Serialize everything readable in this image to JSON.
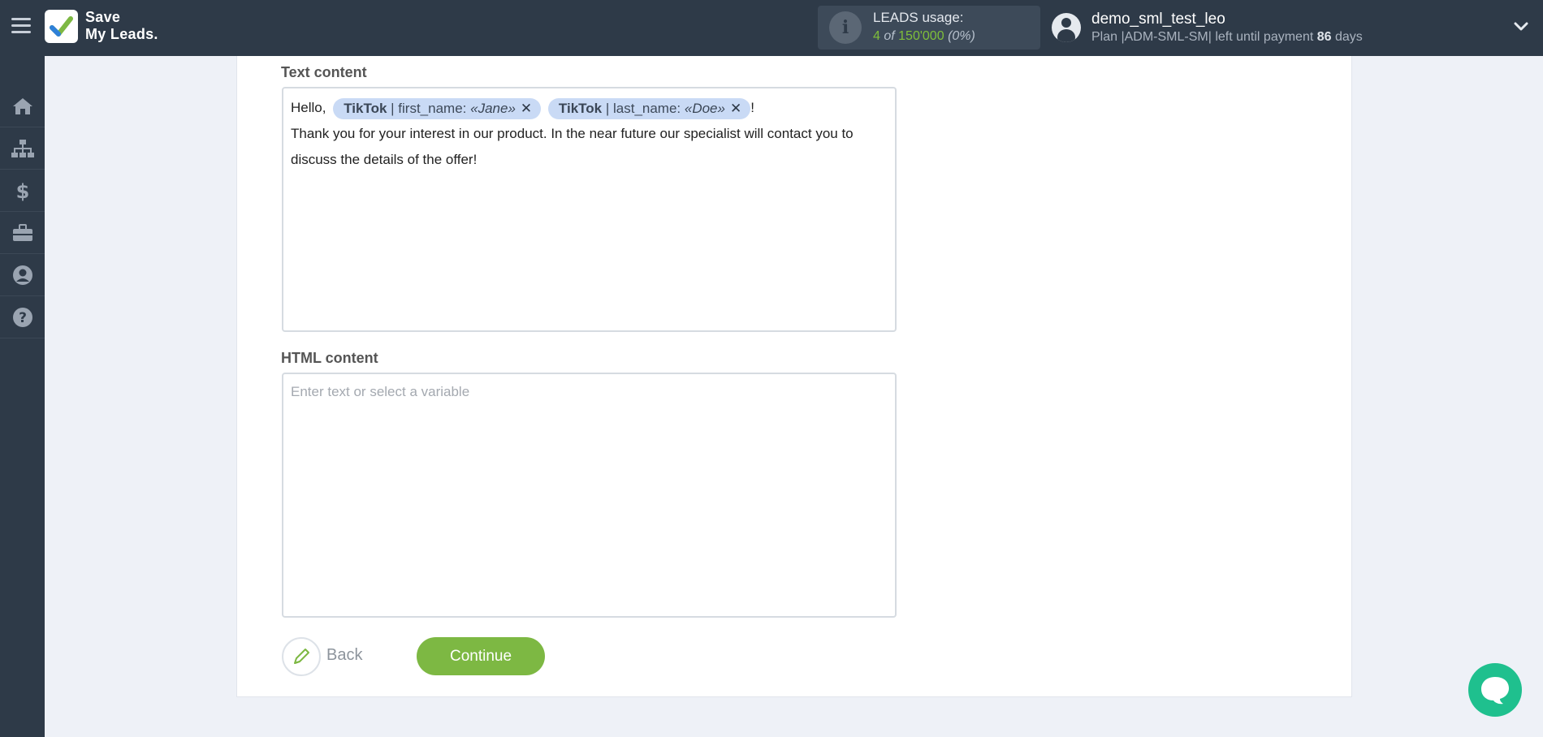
{
  "header": {
    "logo_line1": "Save",
    "logo_line2": "My Leads.",
    "usage_label": "LEADS usage:",
    "usage_used": "4",
    "usage_of": "of",
    "usage_total": "150'000",
    "usage_percent": "(0%)",
    "user_name": "demo_sml_test_leo",
    "plan_prefix": "Plan |ADM-SML-SM| left until payment",
    "plan_days": "86",
    "plan_suffix": "days"
  },
  "sidebar": {
    "items": [
      {
        "icon": "home-icon"
      },
      {
        "icon": "sitemap-icon"
      },
      {
        "icon": "dollar-icon"
      },
      {
        "icon": "briefcase-icon"
      },
      {
        "icon": "user-icon"
      },
      {
        "icon": "help-icon"
      }
    ]
  },
  "form": {
    "text_content_label": "Text content",
    "text_greeting": "Hello,",
    "chip1_source": "TikTok",
    "chip1_field": "| first_name:",
    "chip1_value": "«Jane»",
    "chip2_source": "TikTok",
    "chip2_field": "| last_name:",
    "chip2_value": "«Doe»",
    "text_exclaim": "!",
    "text_body": "Thank you for your interest in our product. In the near future our specialist will contact you to discuss the details of the offer!",
    "html_content_label": "HTML content",
    "html_placeholder": "Enter text or select a variable",
    "back_label": "Back",
    "continue_label": "Continue"
  },
  "colors": {
    "topbar": "#2e3a48",
    "accent_green": "#7db843",
    "chip_bg": "#c9daf5",
    "chat_green": "#1fc08e"
  }
}
